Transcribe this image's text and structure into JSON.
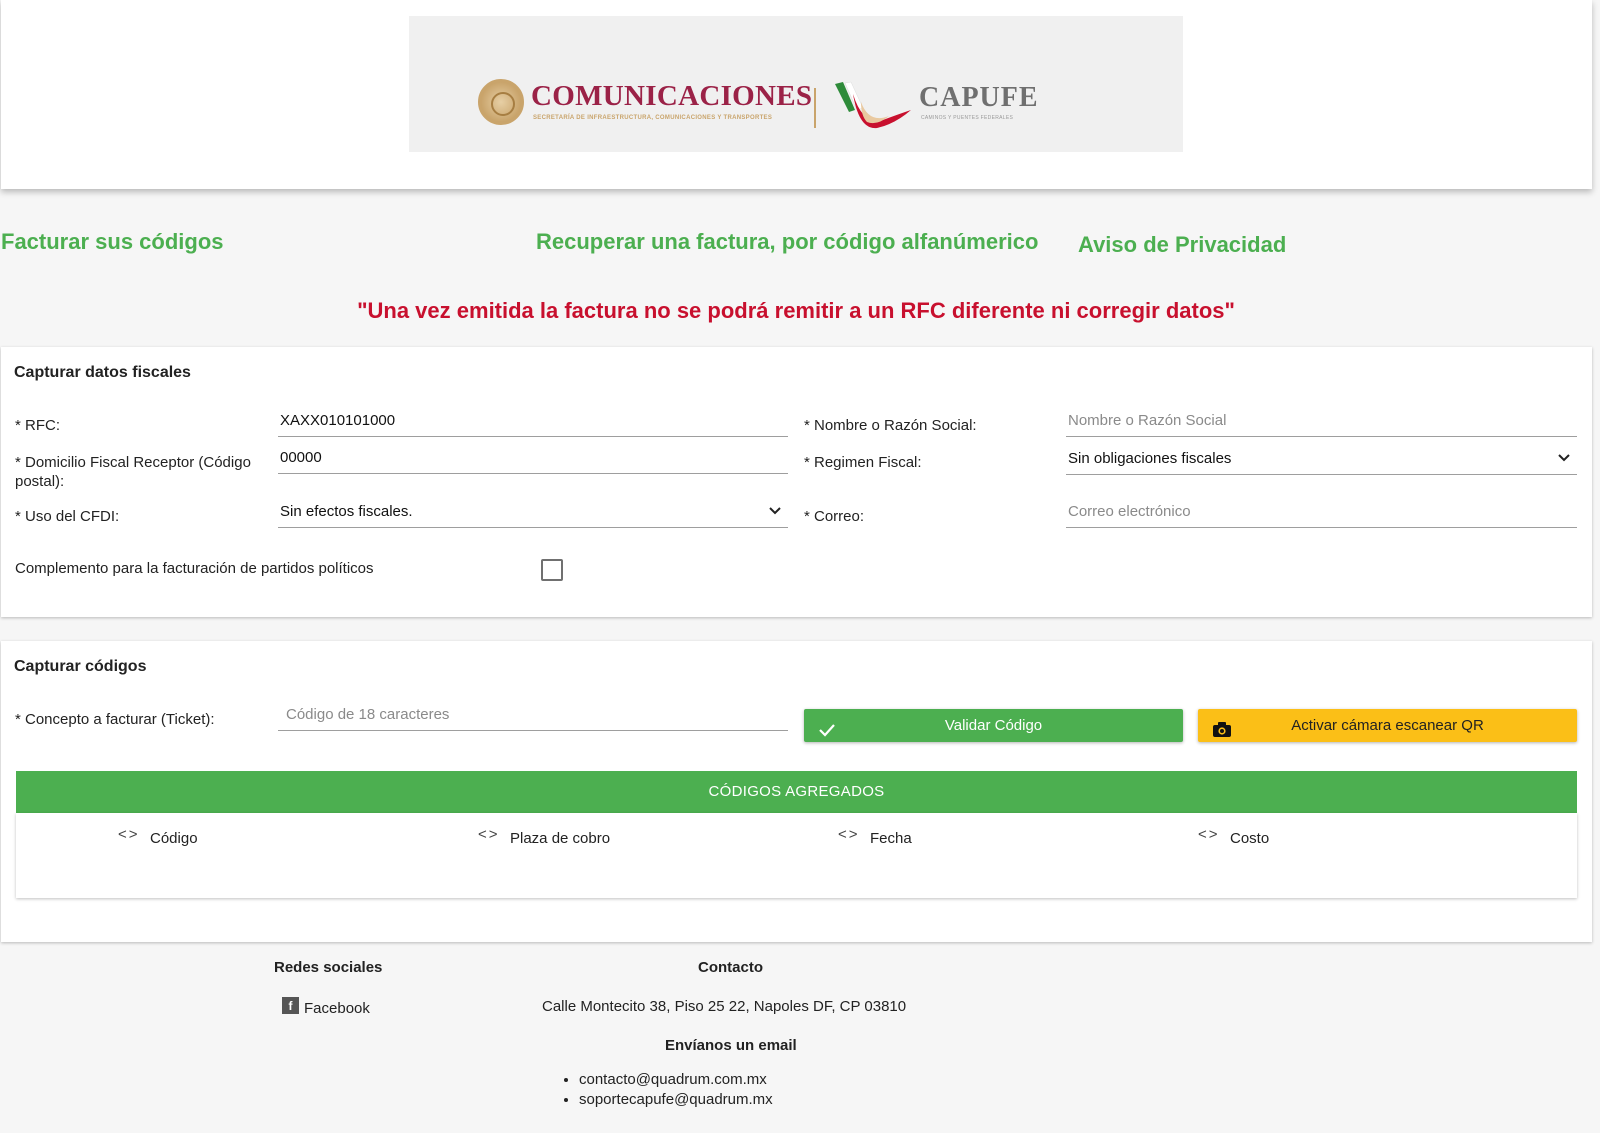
{
  "header": {
    "logo_left_title": "COMUNICACIONES",
    "logo_left_subtitle": "SECRETARÍA DE INFRAESTRUCTURA, COMUNICACIONES Y TRANSPORTES",
    "logo_right_title": "CAPUFE",
    "logo_right_subtitle": "CAMINOS Y PUENTES FEDERALES"
  },
  "nav": {
    "facturar": "Facturar sus códigos",
    "recuperar": "Recuperar una factura, por código alfanúmerico",
    "aviso": "Aviso de Privacidad"
  },
  "warning": "\"Una vez emitida la factura no se podrá remitir a un RFC diferente ni corregir datos\"",
  "fiscal": {
    "title": "Capturar datos fiscales",
    "rfc_label": "* RFC:",
    "rfc_value": "XAXX010101000",
    "nombre_label": "* Nombre o Razón Social:",
    "nombre_placeholder": "Nombre o Razón Social",
    "domicilio_label": "* Domicilio Fiscal Receptor (Código postal):",
    "domicilio_value": "00000",
    "regimen_label": "* Regimen Fiscal:",
    "regimen_value": "Sin obligaciones fiscales",
    "uso_label": "* Uso del CFDI:",
    "uso_value": "Sin efectos fiscales.",
    "correo_label": "* Correo:",
    "correo_placeholder": "Correo electrónico",
    "complemento_label": "Complemento para la facturación de partidos políticos",
    "complemento_checked": false
  },
  "codigos": {
    "title": "Capturar códigos",
    "concepto_label": "* Concepto a facturar (Ticket):",
    "concepto_placeholder": "Código de 18 caracteres",
    "validar_label": "Validar Código",
    "camara_label": "Activar cámara escanear QR",
    "table_title": "CÓDIGOS AGREGADOS",
    "columns": [
      "Código",
      "Plaza de cobro",
      "Fecha",
      "Costo"
    ],
    "sort_icon": "<>"
  },
  "footer": {
    "redes_title": "Redes sociales",
    "facebook_label": "Facebook",
    "facebook_icon_glyph": "f",
    "contacto_title": "Contacto",
    "address": "Calle Montecito 38, Piso 25 22, Napoles DF, CP 03810",
    "email_title": "Envíanos un email",
    "emails": [
      "contacto@quadrum.com.mx",
      "soportecapufe@quadrum.mx"
    ]
  },
  "colors": {
    "accent_green": "#4caf50",
    "warning_red": "#c8102e",
    "button_yellow": "#fbbf17",
    "brand_guinda": "#9b2247",
    "brand_gold": "#c9a46b"
  },
  "icons": [
    "seal-logo-icon",
    "capufe-logo-icon",
    "chevron-down-icon",
    "check-icon",
    "camera-icon",
    "sort-icon",
    "facebook-icon"
  ]
}
